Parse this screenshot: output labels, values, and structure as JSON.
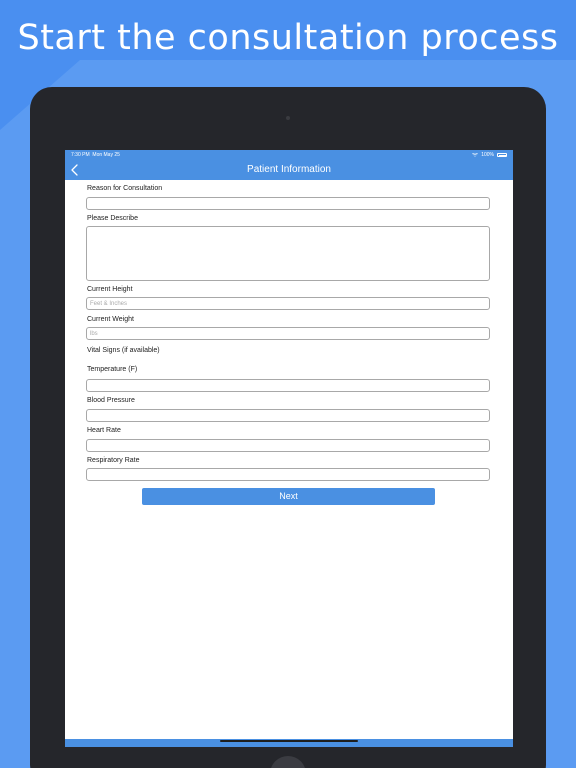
{
  "promo": {
    "headline": "Start the consultation process"
  },
  "status_bar": {
    "time": "7:30 PM",
    "date": "Mon May 25",
    "battery": "100%"
  },
  "nav": {
    "title": "Patient Information",
    "back_icon": "chevron-left-icon"
  },
  "form": {
    "reason_label": "Reason for Consultation",
    "reason_value": "",
    "describe_label": "Please Describe",
    "describe_value": "",
    "height_label": "Current Height",
    "height_placeholder": "Feet & Inches",
    "weight_label": "Current Weight",
    "weight_placeholder": "lbs",
    "vitals_heading": "Vital Signs (if available)",
    "temperature_label": "Temperature (F)",
    "temperature_value": "",
    "blood_pressure_label": "Blood Pressure",
    "blood_pressure_value": "",
    "heart_rate_label": "Heart Rate",
    "heart_rate_value": "",
    "respiratory_rate_label": "Respiratory Rate",
    "respiratory_rate_value": ""
  },
  "actions": {
    "next_label": "Next"
  },
  "colors": {
    "background": "#4a8ff0",
    "accent": "#4a90e2",
    "device": "#25262b"
  }
}
